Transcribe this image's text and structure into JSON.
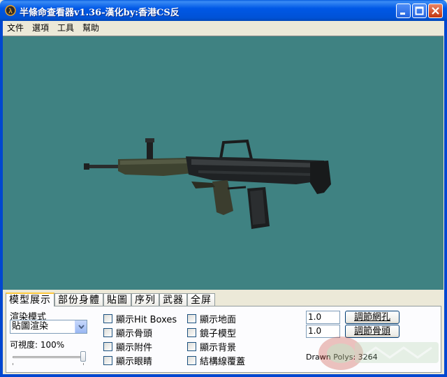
{
  "window": {
    "title": "半條命查看器v1.36-漢化by:香港CS反"
  },
  "menu": [
    "文件",
    "選項",
    "工具",
    "幫助"
  ],
  "tabs": [
    "模型展示",
    "部份身體",
    "貼圖",
    "序列",
    "武器",
    "全屏"
  ],
  "panel": {
    "render_mode_label": "渲染模式",
    "render_mode_value": "貼圖渲染",
    "visibility_label": "可視度: 100%",
    "visibility_value": 1.0,
    "checkboxes_col1": [
      "顯示Hit Boxes",
      "顯示骨頭",
      "顯示附件",
      "顯示眼睛"
    ],
    "checkboxes_col2": [
      "顯示地面",
      "鏡子模型",
      "顯示背景",
      "結構線覆蓋"
    ],
    "input1_value": "1.0",
    "input2_value": "1.0",
    "button1_label": "調節網孔",
    "button2_label": "調節骨頭",
    "drawn_polys": "Drawn Polys: 3264"
  },
  "colors": {
    "viewport_bg": "#3f8282",
    "titlebar": "#0058e6"
  },
  "icons": {
    "app": "hl-icon",
    "minimize": "minimize-icon",
    "maximize": "maximize-icon",
    "close": "close-icon",
    "dropdown": "chevron-down-icon"
  }
}
